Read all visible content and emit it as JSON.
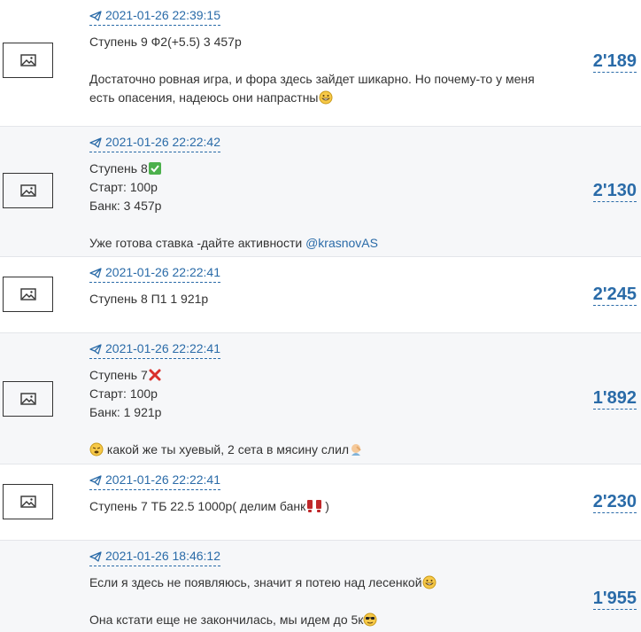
{
  "posts": [
    {
      "date": "2021-01-26 22:39:15",
      "title": "Ступень 9 Ф2(+5.5) 3 457р",
      "text": "Достаточно ровная игра, и фора здесь зайдет шикарно. Но почему-то у меня есть опасения, надеюсь они напрастны",
      "views": "2'189"
    },
    {
      "date": "2021-01-26 22:22:42",
      "title": "Ступень 8",
      "start": "Старт: 100р",
      "bank": "Банк: 3 457р",
      "text": "Уже готова ставка -дайте активности",
      "mention": "@krasnovAS",
      "views": "2'130"
    },
    {
      "date": "2021-01-26 22:22:41",
      "title": "Ступень 8 П1 1 921р",
      "views": "2'245"
    },
    {
      "date": "2021-01-26 22:22:41",
      "title": "Ступень 7",
      "start": "Старт: 100р",
      "bank": "Банк: 1 921р",
      "text": "какой же ты хуевый, 2 сета в мясину слил",
      "views": "1'892"
    },
    {
      "date": "2021-01-26 22:22:41",
      "title_before": "Ступень 7 ТБ 22.5 1000р( делим банк",
      "title_after": ")",
      "views": "2'230"
    },
    {
      "date": "2021-01-26 18:46:12",
      "text1": "Если я здесь не появляюсь, значит я потею над лесенкой",
      "text2": "Она кстати еще не закончилась, мы идем до 5к",
      "views": "1'955"
    }
  ]
}
